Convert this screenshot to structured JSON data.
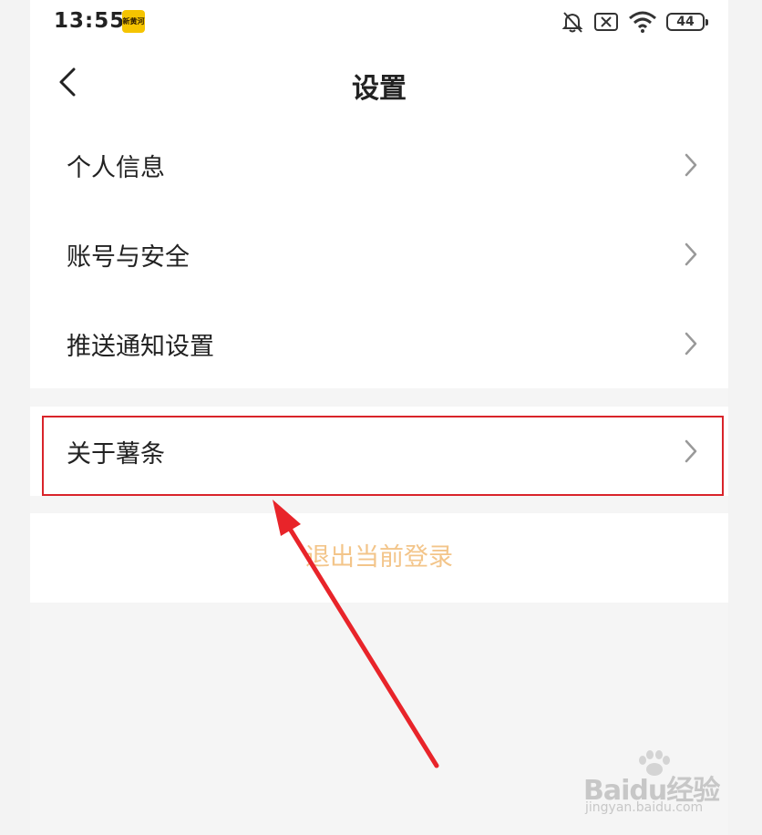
{
  "status_bar": {
    "time": "13:55",
    "app_badge_text": "新黄河",
    "battery": "44",
    "icons": [
      "mute-bell-icon",
      "sim-off-icon",
      "wifi-icon",
      "battery-icon"
    ]
  },
  "header": {
    "title": "设置",
    "back_icon": "chevron-left-icon"
  },
  "settings": {
    "items": [
      {
        "label": "个人信息"
      },
      {
        "label": "账号与安全"
      },
      {
        "label": "推送通知设置"
      }
    ],
    "about": {
      "label": "关于薯条"
    },
    "logout_label": "退出当前登录"
  },
  "annotation": {
    "highlight_color": "#d9242a",
    "arrow_color": "#e8242a"
  },
  "watermark": {
    "main": "Baidu经验",
    "sub": "jingyan.baidu.com"
  },
  "colors": {
    "logout_text": "#f3c58a",
    "background": "#f5f5f5"
  }
}
